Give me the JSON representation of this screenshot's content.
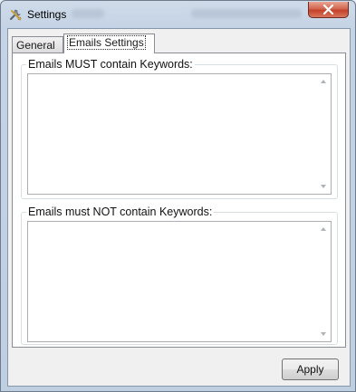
{
  "window": {
    "title": "Settings"
  },
  "tabs": [
    {
      "label": "General",
      "active": false
    },
    {
      "label": "Emails Settings",
      "active": true
    }
  ],
  "groups": {
    "must_contain": {
      "label": "Emails MUST contain Keywords:",
      "value": ""
    },
    "must_not_contain": {
      "label": "Emails must NOT contain Keywords:",
      "value": ""
    }
  },
  "buttons": {
    "apply": "Apply"
  },
  "colors": {
    "titlebar": "#c4d3e5",
    "close_button": "#c4412b",
    "client_background": "#f0f0f0",
    "panel_background": "#ffffff"
  },
  "icons": {
    "app": "settings-tools-icon",
    "close": "close-icon",
    "scroll_up": "scroll-up-arrow-icon",
    "scroll_down": "scroll-down-arrow-icon"
  }
}
